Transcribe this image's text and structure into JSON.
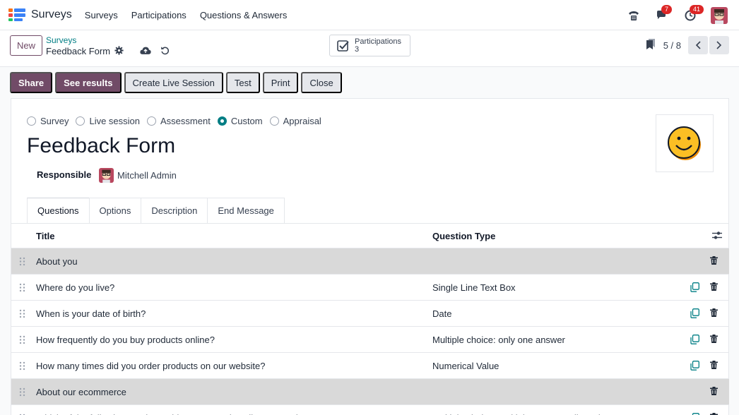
{
  "colors": {
    "brand": "#714b67",
    "accent": "#017e84",
    "danger": "#dc2626"
  },
  "navbar": {
    "app_name": "Surveys",
    "menu": [
      "Surveys",
      "Participations",
      "Questions & Answers"
    ],
    "badges": {
      "messages": "7",
      "activities": "41"
    }
  },
  "control": {
    "new_label": "New",
    "breadcrumb": "Surveys",
    "record_title": "Feedback Form",
    "smart_button": {
      "label": "Participations",
      "value": "3"
    },
    "pager": "5 / 8"
  },
  "actions": [
    {
      "label": "Share",
      "style": "primary"
    },
    {
      "label": "See results",
      "style": "primary"
    },
    {
      "label": "Create Live Session",
      "style": "secondary"
    },
    {
      "label": "Test",
      "style": "secondary"
    },
    {
      "label": "Print",
      "style": "secondary"
    },
    {
      "label": "Close",
      "style": "secondary"
    }
  ],
  "form": {
    "survey_types": [
      {
        "label": "Survey",
        "checked": false
      },
      {
        "label": "Live session",
        "checked": false
      },
      {
        "label": "Assessment",
        "checked": false
      },
      {
        "label": "Custom",
        "checked": true
      },
      {
        "label": "Appraisal",
        "checked": false
      }
    ],
    "title": "Feedback Form",
    "responsible_label": "Responsible",
    "responsible_name": "Mitchell Admin",
    "tabs": [
      "Questions",
      "Options",
      "Description",
      "End Message"
    ],
    "active_tab": "Questions"
  },
  "table": {
    "headers": {
      "title": "Title",
      "type": "Question Type"
    },
    "rows": [
      {
        "title": "About you",
        "type": "",
        "section": true
      },
      {
        "title": "Where do you live?",
        "type": "Single Line Text Box",
        "section": false
      },
      {
        "title": "When is your date of birth?",
        "type": "Date",
        "section": false
      },
      {
        "title": "How frequently do you buy products online?",
        "type": "Multiple choice: only one answer",
        "section": false
      },
      {
        "title": "How many times did you order products on our website?",
        "type": "Numerical Value",
        "section": false
      },
      {
        "title": "About our ecommerce",
        "type": "",
        "section": true
      },
      {
        "title": "Which of the following words would you use to describe our products?",
        "type": "Multiple choice: multiple answers allowed",
        "section": false
      }
    ]
  }
}
